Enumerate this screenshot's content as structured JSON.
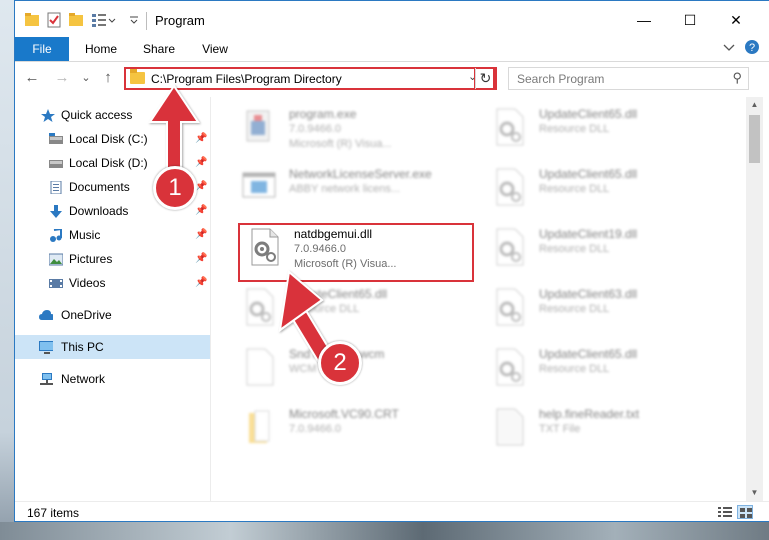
{
  "window": {
    "title": "Program",
    "min_label": "—",
    "max_label": "☐",
    "close_label": "✕"
  },
  "ribbon": {
    "tabs": [
      "File",
      "Home",
      "Share",
      "View"
    ],
    "expand_icon": "chevron-down-icon",
    "help_icon": "help-icon"
  },
  "nav": {
    "back": "←",
    "forward": "→",
    "recent": "⌄",
    "up": "↑",
    "address_path": "C:\\Program Files\\Program Directory",
    "address_dropdown": "⌄",
    "refresh": "↻",
    "search_placeholder": "Search Program",
    "search_icon_glyph": "⚲"
  },
  "sidebar": {
    "items": [
      {
        "label": "Quick access",
        "icon": "star-icon",
        "pinned": false
      },
      {
        "label": "Local Disk (C:)",
        "icon": "drive-icon",
        "pinned": true
      },
      {
        "label": "Local Disk (D:)",
        "icon": "drive-icon",
        "pinned": true
      },
      {
        "label": "Documents",
        "icon": "documents-icon",
        "pinned": true
      },
      {
        "label": "Downloads",
        "icon": "downloads-icon",
        "pinned": true
      },
      {
        "label": "Music",
        "icon": "music-icon",
        "pinned": true
      },
      {
        "label": "Pictures",
        "icon": "pictures-icon",
        "pinned": true
      },
      {
        "label": "Videos",
        "icon": "videos-icon",
        "pinned": true
      },
      {
        "label": "OneDrive",
        "icon": "cloud-icon",
        "pinned": false
      },
      {
        "label": "This PC",
        "icon": "computer-icon",
        "pinned": false,
        "selected": true
      },
      {
        "label": "Network",
        "icon": "network-icon",
        "pinned": false
      }
    ],
    "pin_glyph": "📌"
  },
  "files": {
    "left": [
      {
        "name": "program.exe",
        "line1": "7.0.9466.0",
        "line2": "Microsoft (R) Visua...",
        "icon": "installer-icon"
      },
      {
        "name": "NetworkLicenseServer.exe",
        "line1": "ABBY network licens...",
        "line2": "",
        "icon": "app-window-icon"
      },
      {
        "name": "natdbgemui.dll",
        "line1": "7.0.9466.0",
        "line2": "Microsoft (R) Visua...",
        "icon": "dll-gear-icon",
        "highlight": true
      },
      {
        "name": "UpdateClient65.dll",
        "line1": "Resource DLL",
        "line2": "",
        "icon": "dll-gear-icon"
      },
      {
        "name": "SndToolbar5.wcm",
        "line1": "WCM File",
        "line2": "",
        "icon": "file-icon"
      },
      {
        "name": "Microsoft.VC90.CRT",
        "line1": "7.0.9466.0",
        "line2": "",
        "icon": "folder-icon"
      }
    ],
    "right": [
      {
        "name": "UpdateClient65.dll",
        "line1": "Resource DLL",
        "icon": "dll-gear-icon"
      },
      {
        "name": "UpdateClient65.dll",
        "line1": "Resource DLL",
        "icon": "dll-gear-icon"
      },
      {
        "name": "UpdateClient19.dll",
        "line1": "Resource DLL",
        "icon": "dll-gear-icon"
      },
      {
        "name": "UpdateClient63.dll",
        "line1": "Resource DLL",
        "icon": "dll-gear-icon"
      },
      {
        "name": "UpdateClient65.dll",
        "line1": "Resource DLL",
        "icon": "dll-gear-icon"
      },
      {
        "name": "help.fineReader.txt",
        "line1": "TXT File",
        "icon": "text-file-icon"
      }
    ]
  },
  "status": {
    "item_count": "167 items"
  },
  "annotations": {
    "badge1": "1",
    "badge2": "2"
  },
  "colors": {
    "accent": "#1979ca",
    "highlight_red": "#d9333a",
    "selected_bg": "#cce4f7"
  }
}
